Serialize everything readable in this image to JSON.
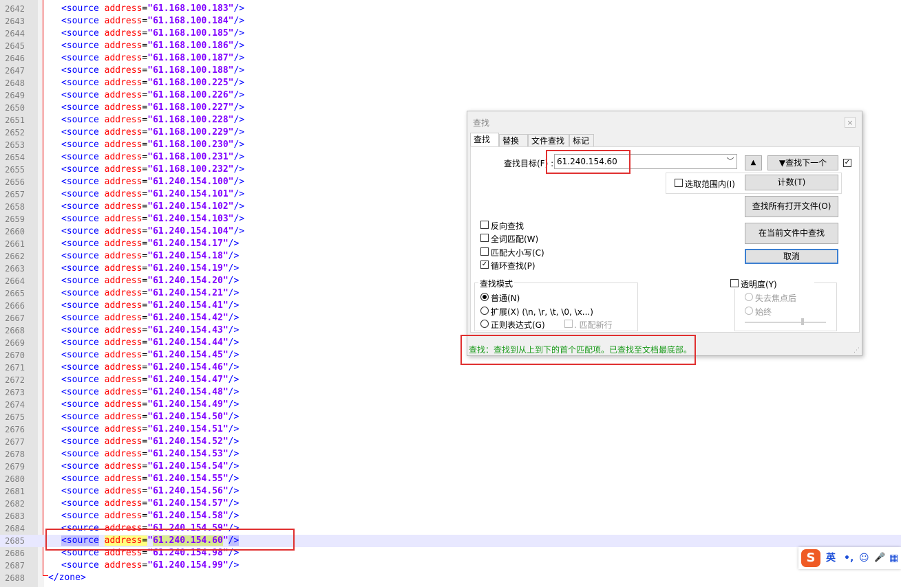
{
  "editor": {
    "lines": [
      {
        "n": "2642",
        "ip": "61.168.100.183"
      },
      {
        "n": "2643",
        "ip": "61.168.100.184"
      },
      {
        "n": "2644",
        "ip": "61.168.100.185"
      },
      {
        "n": "2645",
        "ip": "61.168.100.186"
      },
      {
        "n": "2646",
        "ip": "61.168.100.187"
      },
      {
        "n": "2647",
        "ip": "61.168.100.188"
      },
      {
        "n": "2648",
        "ip": "61.168.100.225"
      },
      {
        "n": "2649",
        "ip": "61.168.100.226"
      },
      {
        "n": "2650",
        "ip": "61.168.100.227"
      },
      {
        "n": "2651",
        "ip": "61.168.100.228"
      },
      {
        "n": "2652",
        "ip": "61.168.100.229"
      },
      {
        "n": "2653",
        "ip": "61.168.100.230"
      },
      {
        "n": "2654",
        "ip": "61.168.100.231"
      },
      {
        "n": "2655",
        "ip": "61.168.100.232"
      },
      {
        "n": "2656",
        "ip": "61.240.154.100"
      },
      {
        "n": "2657",
        "ip": "61.240.154.101"
      },
      {
        "n": "2658",
        "ip": "61.240.154.102"
      },
      {
        "n": "2659",
        "ip": "61.240.154.103"
      },
      {
        "n": "2660",
        "ip": "61.240.154.104"
      },
      {
        "n": "2661",
        "ip": "61.240.154.17"
      },
      {
        "n": "2662",
        "ip": "61.240.154.18"
      },
      {
        "n": "2663",
        "ip": "61.240.154.19"
      },
      {
        "n": "2664",
        "ip": "61.240.154.20"
      },
      {
        "n": "2665",
        "ip": "61.240.154.21"
      },
      {
        "n": "2666",
        "ip": "61.240.154.41"
      },
      {
        "n": "2667",
        "ip": "61.240.154.42"
      },
      {
        "n": "2668",
        "ip": "61.240.154.43"
      },
      {
        "n": "2669",
        "ip": "61.240.154.44"
      },
      {
        "n": "2670",
        "ip": "61.240.154.45"
      },
      {
        "n": "2671",
        "ip": "61.240.154.46"
      },
      {
        "n": "2672",
        "ip": "61.240.154.47"
      },
      {
        "n": "2673",
        "ip": "61.240.154.48"
      },
      {
        "n": "2674",
        "ip": "61.240.154.49"
      },
      {
        "n": "2675",
        "ip": "61.240.154.50"
      },
      {
        "n": "2676",
        "ip": "61.240.154.51"
      },
      {
        "n": "2677",
        "ip": "61.240.154.52"
      },
      {
        "n": "2678",
        "ip": "61.240.154.53"
      },
      {
        "n": "2679",
        "ip": "61.240.154.54"
      },
      {
        "n": "2680",
        "ip": "61.240.154.55"
      },
      {
        "n": "2681",
        "ip": "61.240.154.56"
      },
      {
        "n": "2682",
        "ip": "61.240.154.57"
      },
      {
        "n": "2683",
        "ip": "61.240.154.58"
      },
      {
        "n": "2684",
        "ip": "61.240.154.59"
      },
      {
        "n": "2685",
        "ip": "61.240.154.60",
        "current": true
      },
      {
        "n": "2686",
        "ip": "61.240.154.98"
      },
      {
        "n": "2687",
        "ip": "61.240.154.99"
      }
    ],
    "closing_line": {
      "n": "2688",
      "text": "</zone>"
    },
    "tag_text": "<source",
    "attr_text": "address",
    "end_text": "/>"
  },
  "find_dialog": {
    "title": "查找",
    "close_label": "×",
    "tabs": [
      "查找",
      "替换",
      "文件查找",
      "标记"
    ],
    "search_label": "查找目标(F) :",
    "search_value": "61.240.154.60",
    "combo_arrow": "﹀",
    "up_button": "▲",
    "find_next_button": "▼查找下一个",
    "in_selection_label": "选取范围内(I)",
    "count_button": "计数(T)",
    "find_all_open_button": "查找所有打开文件(O)",
    "find_current_button": "在当前文件中查找",
    "cancel_button": "取消",
    "options": [
      {
        "label": "反向查找",
        "checked": false
      },
      {
        "label": "全词匹配(W)",
        "checked": false
      },
      {
        "label": "匹配大小写(C)",
        "checked": false
      },
      {
        "label": "循环查找(P)",
        "checked": true
      }
    ],
    "search_mode_title": "查找模式",
    "modes": [
      {
        "label": "普通(N)",
        "selected": true
      },
      {
        "label": "扩展(X) (\\n, \\r, \\t, \\0, \\x...)",
        "selected": false
      },
      {
        "label": "正则表达式(G)",
        "selected": false
      }
    ],
    "dot_newline_label": ". 匹配新行",
    "transparency_label": "透明度(Y)",
    "transparency_options": [
      "失去焦点后",
      "始终"
    ],
    "status_text": "查找：查找到从上到下的首个匹配项。已查找至文档最底部。",
    "check_mark": "✓",
    "grip_mark": "⋰"
  },
  "ime": {
    "logo": "S",
    "items": [
      "英",
      "•,",
      "☺",
      "🎤",
      "▦"
    ]
  },
  "colors": {
    "tag": "#0000ff",
    "attr": "#ff0000",
    "value": "#8000ff",
    "annotation": "#e03030",
    "status": "#1a9a1a"
  }
}
